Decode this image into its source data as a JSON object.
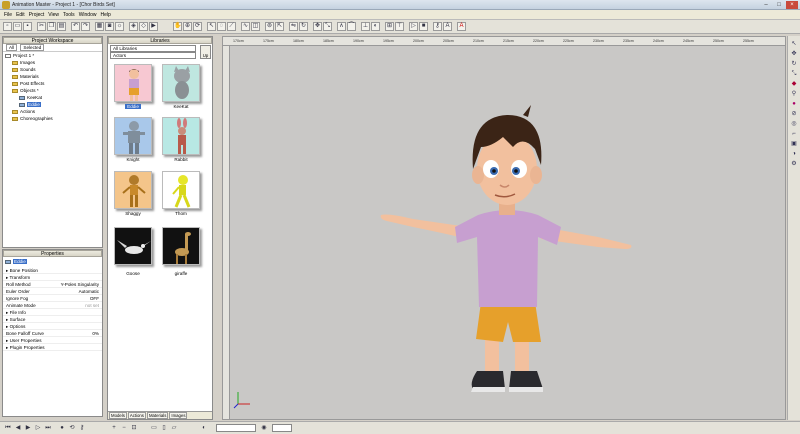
{
  "window": {
    "title": "Animation Master - Project 1 - [Chor Birds Set]"
  },
  "menu": [
    "File",
    "Edit",
    "Project",
    "View",
    "Tools",
    "Window",
    "Help"
  ],
  "workspace": {
    "header": "Project Workspace",
    "filter": "All",
    "selected_tab": "Selected",
    "tree": [
      {
        "label": "Project 1 *",
        "indent": 0,
        "folder": false
      },
      {
        "label": "Images",
        "indent": 1,
        "folder": true
      },
      {
        "label": "Sounds",
        "indent": 1,
        "folder": true
      },
      {
        "label": "Materials",
        "indent": 1,
        "folder": true
      },
      {
        "label": "Post Effects",
        "indent": 1,
        "folder": true
      },
      {
        "label": "Objects *",
        "indent": 1,
        "folder": true
      },
      {
        "label": "KeeKat",
        "indent": 2,
        "folder": false
      },
      {
        "label": "Eddie",
        "indent": 2,
        "folder": false,
        "selected": true
      },
      {
        "label": "Actions",
        "indent": 1,
        "folder": true
      },
      {
        "label": "Choreographies",
        "indent": 1,
        "folder": true
      }
    ]
  },
  "properties": {
    "header": "Properties",
    "selected": "Eddie",
    "rows": [
      {
        "k": "Bone Position",
        "v": ""
      },
      {
        "k": "Transform",
        "v": ""
      },
      {
        "k": "Roll Method",
        "v": "Y-Poles Singularity"
      },
      {
        "k": "Euler Order",
        "v": "Automatic"
      },
      {
        "k": "Ignore Fog",
        "v": "OFF"
      },
      {
        "k": "Animate Mode",
        "v": "not set"
      },
      {
        "k": "File Info",
        "v": ""
      },
      {
        "k": "Surface",
        "v": ""
      },
      {
        "k": "Options",
        "v": ""
      },
      {
        "k": "Bone Falloff Curve",
        "v": "0%"
      },
      {
        "k": "User Properties",
        "v": ""
      },
      {
        "k": "Plugin Properties",
        "v": ""
      }
    ]
  },
  "libraries": {
    "header": "Libraries",
    "dropdown": "All Libraries",
    "category": "Actors",
    "up_label": "Up",
    "items": [
      {
        "label": "Eddie",
        "bg": "#f7c8d2",
        "selected": true
      },
      {
        "label": "KeeKat",
        "bg": "#bfe7e0"
      },
      {
        "label": "Knight",
        "bg": "#a9c8ea"
      },
      {
        "label": "Rabbit",
        "bg": "#b8e8e4"
      },
      {
        "label": "Shaggy",
        "bg": "#f4c58a"
      },
      {
        "label": "Thom",
        "bg": "#ffffff"
      },
      {
        "label": "Goose",
        "bg": "#111111"
      },
      {
        "label": "giraffe",
        "bg": "#111111"
      }
    ],
    "tabs": [
      "Models",
      "Actions",
      "Materials",
      "Images"
    ]
  },
  "viewport": {
    "ruler": [
      "170cm",
      "175cm",
      "180cm",
      "185cm",
      "190cm",
      "195cm",
      "200cm",
      "205cm",
      "210cm",
      "215cm",
      "220cm",
      "225cm",
      "230cm",
      "235cm",
      "240cm",
      "245cm",
      "250cm",
      "255cm"
    ]
  },
  "colors": {
    "shirt": "#c79fd0",
    "shorts": "#e6a02b",
    "skin": "#f2c09e",
    "hair": "#3b2416",
    "bg": "#c9c8c6"
  }
}
